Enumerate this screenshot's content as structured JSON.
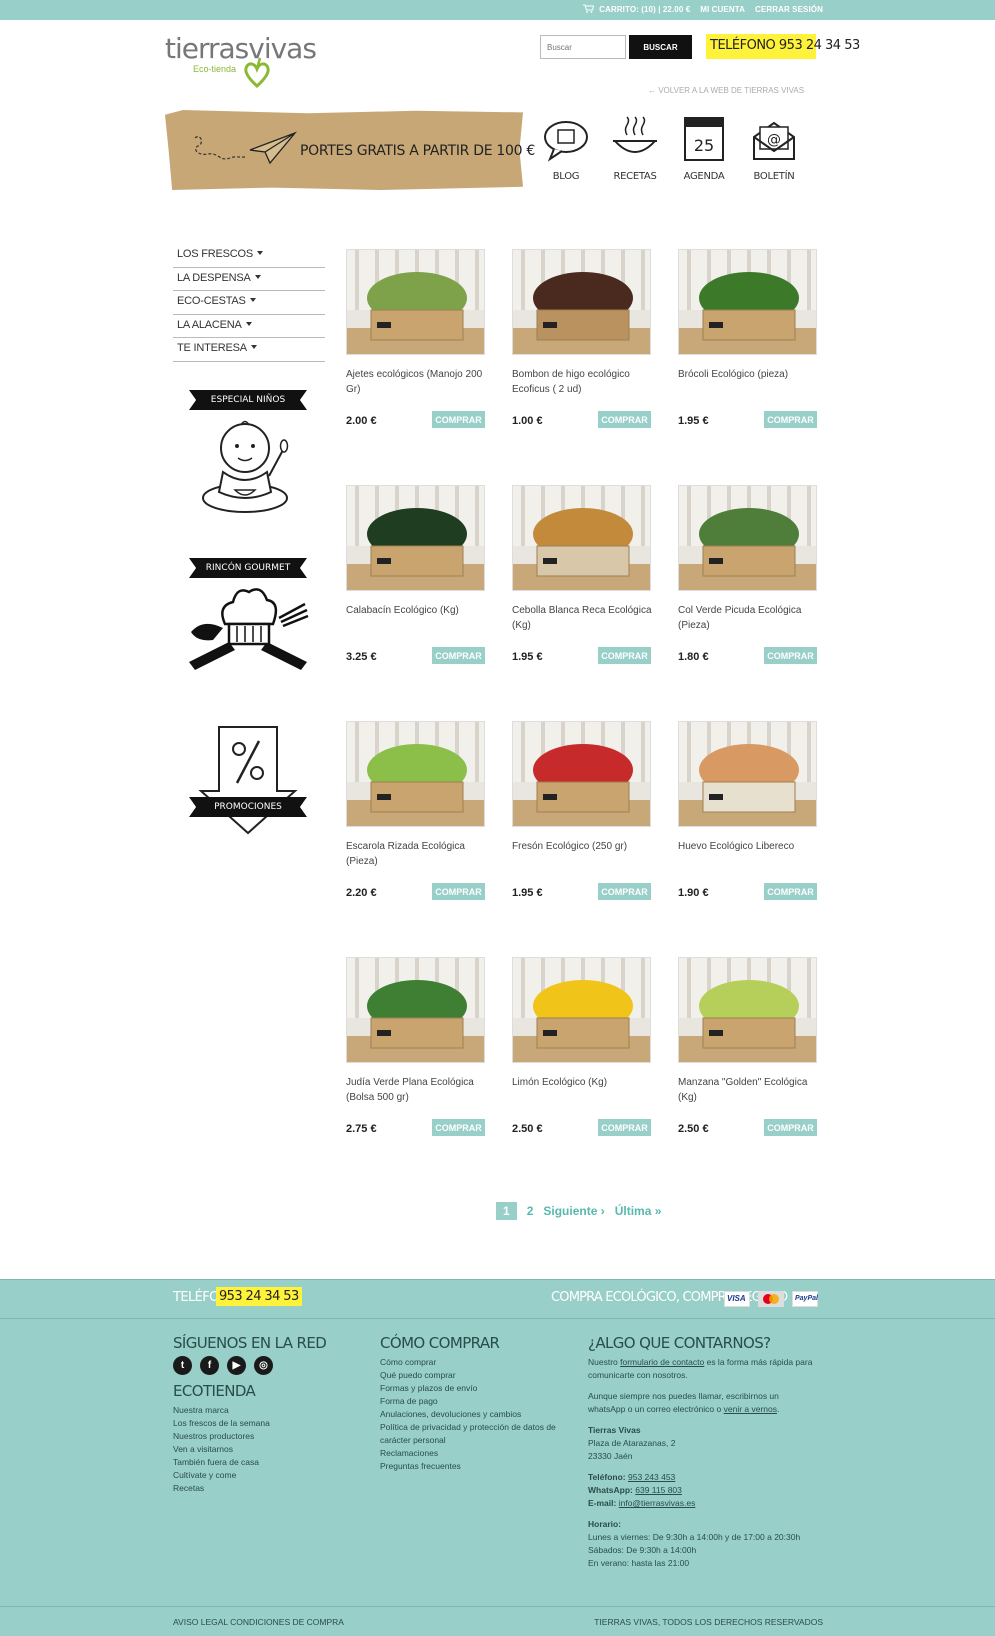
{
  "topbar": {
    "cart_label": "CARRITO: (10)",
    "cart_total": "22.00 €",
    "my_account": "MI CUENTA",
    "logout": "CERRAR SESIÓN"
  },
  "header": {
    "logo_name": "tierrasvivas",
    "logo_sub": "Eco-tienda",
    "search_placeholder": "Buscar",
    "search_button": "BUSCAR",
    "phone": "TELÉFONO 953 24 34 53",
    "back_link": "← VOLVER A LA WEB DE TIERRAS VIVAS"
  },
  "banner": {
    "text": "PORTES GRATIS A PARTIR DE 100 €"
  },
  "quick_links": [
    {
      "label": "BLOG",
      "icon": "blog-icon"
    },
    {
      "label": "RECETAS",
      "icon": "recipes-icon"
    },
    {
      "label": "AGENDA",
      "icon": "calendar-icon",
      "day": "25"
    },
    {
      "label": "BOLETÍN",
      "icon": "newsletter-icon"
    }
  ],
  "sidebar": {
    "items": [
      {
        "label": "LOS FRESCOS"
      },
      {
        "label": "LA DESPENSA"
      },
      {
        "label": "ECO-CESTAS"
      },
      {
        "label": "LA ALACENA"
      },
      {
        "label": "TE INTERESA"
      }
    ],
    "promos": [
      {
        "label": "ESPECIAL NIÑOS"
      },
      {
        "label": "RINCÓN GOURMET"
      },
      {
        "label": "PROMOCIONES"
      }
    ]
  },
  "products": [
    {
      "name": "Ajetes ecológicos (Manojo 200 Gr)",
      "price": "2.00 €",
      "button": "COMPRAR"
    },
    {
      "name": "Bombon de higo ecológico Ecoficus ( 2 ud)",
      "price": "1.00 €",
      "button": "COMPRAR"
    },
    {
      "name": "Brócoli Ecológico (pieza)",
      "price": "1.95 €",
      "button": "COMPRAR"
    },
    {
      "name": "Calabacín Ecológico (Kg)",
      "price": "3.25 €",
      "button": "COMPRAR"
    },
    {
      "name": "Cebolla Blanca Reca Ecológica (Kg)",
      "price": "1.95 €",
      "button": "COMPRAR"
    },
    {
      "name": "Col Verde Picuda Ecológica (Pieza)",
      "price": "1.80 €",
      "button": "COMPRAR"
    },
    {
      "name": "Escarola Rizada Ecológica (Pieza)",
      "price": "2.20 €",
      "button": "COMPRAR"
    },
    {
      "name": "Fresón Ecológico (250 gr)",
      "price": "1.95 €",
      "button": "COMPRAR"
    },
    {
      "name": "Huevo Ecológico Libereco",
      "price": "1.90 €",
      "button": "COMPRAR"
    },
    {
      "name": "Judía Verde Plana Ecológica (Bolsa 500 gr)",
      "price": "2.75 €",
      "button": "COMPRAR"
    },
    {
      "name": "Limón Ecológico (Kg)",
      "price": "2.50 €",
      "button": "COMPRAR"
    },
    {
      "name": "Manzana \"Golden\" Ecológica (Kg)",
      "price": "2.50 €",
      "button": "COMPRAR"
    }
  ],
  "pagination": {
    "current": "1",
    "next_page": "2",
    "next": "Siguiente ›",
    "last": "Última »"
  },
  "footer": {
    "phone_label": "TELÉFONO",
    "phone": "953 24 34 53",
    "slogan": "COMPRA ECOLÓGICO, COMPRA SEGURO",
    "payments": [
      "VISA",
      "MasterCard",
      "PayPal"
    ],
    "social_heading": "SÍGUENOS EN LA RED",
    "social": [
      "twitter-icon",
      "facebook-icon",
      "youtube-icon",
      "instagram-icon"
    ],
    "ecotienda_heading": "ECOTIENDA",
    "ecotienda_links": [
      "Nuestra marca",
      "Los frescos de la semana",
      "Nuestros productores",
      "Ven a visitarnos",
      "También fuera de casa",
      "Cultívate y come",
      "Recetas"
    ],
    "howto_heading": "CÓMO COMPRAR",
    "howto_links": [
      "Cómo comprar",
      "Qué puedo comprar",
      "Formas y plazos de envío",
      "Forma de pago",
      "Anulaciones, devoluciones y cambios",
      "Política de privacidad y protección de datos de carácter personal",
      "Reclamaciones",
      "Preguntas frecuentes"
    ],
    "contact_heading": "¿ALGO QUE CONTARNOS?",
    "contact_p1_a": "Nuestro ",
    "contact_p1_link": "formulario de contacto",
    "contact_p1_b": " es la forma más rápida para comunicarte con nosotros.",
    "contact_p2_a": "Aunque siempre nos puedes llamar, escribirnos un whatsApp o un correo electrónico o ",
    "contact_p2_link": "venir a vernos",
    "contact_p2_b": ".",
    "company": "Tierras Vivas",
    "address1": "Plaza de Atarazanas, 2",
    "address2": "23330 Jaén",
    "phone_lbl": "Teléfono:",
    "phone_val": "953 243 453",
    "whatsapp_lbl": "WhatsApp:",
    "whatsapp_val": "639 115 803",
    "email_lbl": "E-mail:",
    "email_val": "info@tierrasvivas.es",
    "hours_lbl": "Horario:",
    "hours1": "Lunes a viernes: De 9:30h a 14:00h y de 17:00 a 20:30h",
    "hours2": "Sábados: De 9:30h a 14:00h",
    "hours3": "En verano: hasta las 21:00",
    "legal_left": "AVISO LEGAL CONDICIONES DE COMPRA",
    "legal_right": "TIERRAS VIVAS, TODOS LOS DERECHOS RESERVADOS"
  }
}
